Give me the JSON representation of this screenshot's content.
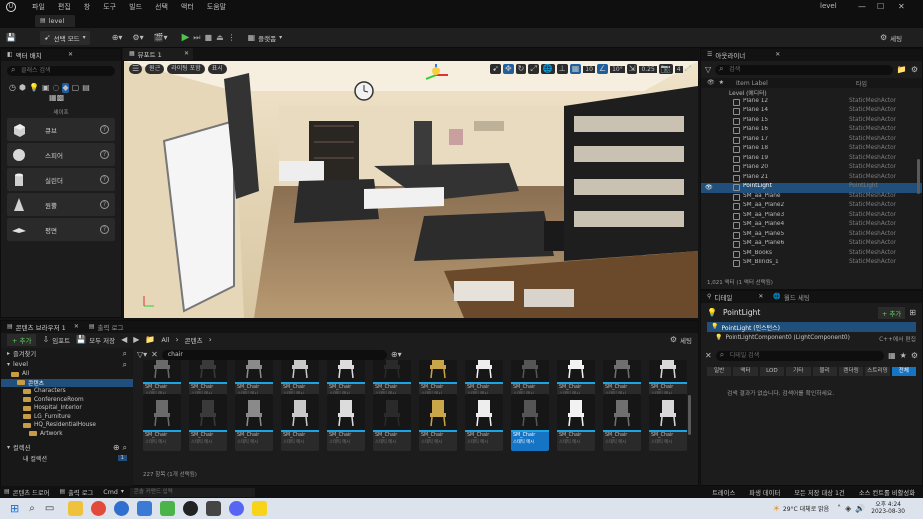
{
  "window": {
    "level_name": "level",
    "tab_label": "level",
    "menu": [
      "파일",
      "편집",
      "창",
      "도구",
      "빌드",
      "선택",
      "액터",
      "도움말"
    ],
    "controls": [
      "—",
      "☐",
      "✕"
    ]
  },
  "toolbar": {
    "save_label": "저장",
    "mode_label": "선택 모드",
    "platform_label": "플랫폼",
    "settings_label": "세팅"
  },
  "place_actors": {
    "tab_label": "액터 배치",
    "search_placeholder": "클래스 검색",
    "category_label": "셰이프",
    "items": [
      {
        "label": "큐브",
        "icon": "cube-icon"
      },
      {
        "label": "스피어",
        "icon": "sphere-icon"
      },
      {
        "label": "실린더",
        "icon": "cylinder-icon"
      },
      {
        "label": "원뿔",
        "icon": "cone-icon"
      },
      {
        "label": "평면",
        "icon": "plane-icon"
      }
    ]
  },
  "viewport": {
    "tab_label": "뷰포트 1",
    "left_buttons": [
      "원근",
      "라이팅 포함",
      "표시"
    ],
    "snap_values": [
      "10",
      "10°",
      "0.25",
      "4"
    ]
  },
  "outliner": {
    "tab_label": "아웃라이너",
    "search_placeholder": "검색",
    "col_item": "Item Label",
    "col_type": "타입",
    "level_row": "Level (에디터)",
    "rows": [
      {
        "name": "Plane 12",
        "type": "StaticMeshActor"
      },
      {
        "name": "Plane 14",
        "type": "StaticMeshActor"
      },
      {
        "name": "Plane 15",
        "type": "StaticMeshActor"
      },
      {
        "name": "Plane 16",
        "type": "StaticMeshActor"
      },
      {
        "name": "Plane 17",
        "type": "StaticMeshActor"
      },
      {
        "name": "Plane 18",
        "type": "StaticMeshActor"
      },
      {
        "name": "Plane 19",
        "type": "StaticMeshActor"
      },
      {
        "name": "Plane 20",
        "type": "StaticMeshActor"
      },
      {
        "name": "Plane 21",
        "type": "StaticMeshActor"
      },
      {
        "name": "PointLight",
        "type": "PointLight",
        "selected": true
      },
      {
        "name": "SM_aa_Plane",
        "type": "StaticMeshActor"
      },
      {
        "name": "SM_aa_Plane2",
        "type": "StaticMeshActor"
      },
      {
        "name": "SM_aa_Plane3",
        "type": "StaticMeshActor"
      },
      {
        "name": "SM_aa_Plane4",
        "type": "StaticMeshActor"
      },
      {
        "name": "SM_aa_Plane5",
        "type": "StaticMeshActor"
      },
      {
        "name": "SM_aa_Plane6",
        "type": "StaticMeshActor"
      },
      {
        "name": "SM_Books",
        "type": "StaticMeshActor"
      },
      {
        "name": "SM_Blinds_1",
        "type": "StaticMeshActor"
      }
    ],
    "footer": "1,021 액터 (1 액터 선택됨)"
  },
  "details": {
    "tab_label": "디테일",
    "tab2_label": "월드 세팅",
    "actor_name": "PointLight",
    "add_label": "+ 추가",
    "component_root": "PointLight (인스턴스)",
    "component_child": "PointLightComponent0 (LightComponent0)",
    "component_child_note": "C++에서 편집",
    "search_placeholder": "디테일 검색",
    "filter_tabs": [
      "일반",
      "액터",
      "LOD",
      "기타",
      "물리",
      "렌더링",
      "스트리밍",
      "전체"
    ],
    "hint": "검색 결과가 없습니다. 검색어를 확인하세요."
  },
  "content_browser": {
    "tab_label": "콘텐츠 브라우저 1",
    "tab2_label": "출력 로그",
    "add_label": "+ 추가",
    "import_label": "임포트",
    "save_all_label": "모두 저장",
    "path": [
      "All",
      "콘텐츠"
    ],
    "settings_label": "세팅",
    "favorites_label": "즐겨찾기",
    "project_label": "level",
    "filter_text": "chair",
    "tree": [
      "All",
      "콘텐츠",
      "Characters",
      "ConferenceRoom",
      "Hospital_Interior",
      "LG_Furniture",
      "HQ_ResidentialHouse",
      "Artwork"
    ],
    "collections_label": "컬렉션",
    "history_label": "내 컬렉션",
    "history_count": "1",
    "status": "227 항목 (1개 선택됨)",
    "row1": [
      {
        "name": "SM_Chair",
        "type": "스태틱 메시"
      },
      {
        "name": "SM_Chair",
        "type": "스태틱 메시"
      },
      {
        "name": "SM_Chair",
        "type": "스태틱 메시"
      },
      {
        "name": "SM_Chair",
        "type": "스태틱 메시"
      },
      {
        "name": "SM_Chair",
        "type": "스태틱 메시"
      },
      {
        "name": "SM_Chair",
        "type": "스태틱 메시"
      },
      {
        "name": "SM_Chair",
        "type": "스태틱 메시"
      },
      {
        "name": "SM_Chair",
        "type": "스태틱 메시"
      },
      {
        "name": "SM_Chair",
        "type": "스태틱 메시"
      },
      {
        "name": "SM_Chair",
        "type": "스태틱 메시"
      },
      {
        "name": "SM_Chair",
        "type": "스태틱 메시"
      },
      {
        "name": "SM_Chair",
        "type": "스태틱 메시"
      }
    ],
    "row2": [
      {
        "name": "SM_Chair",
        "type": "스태틱 메시"
      },
      {
        "name": "SM_Chair",
        "type": "스태틱 메시"
      },
      {
        "name": "SM_Chair",
        "type": "스태틱 메시"
      },
      {
        "name": "SM_Chair",
        "type": "스태틱 메시"
      },
      {
        "name": "SM_Chair",
        "type": "스태틱 메시"
      },
      {
        "name": "SM_Chair",
        "type": "스태틱 메시"
      },
      {
        "name": "SM_Chair",
        "type": "스태틱 메시"
      },
      {
        "name": "SM_Chair",
        "type": "스태틱 메시"
      },
      {
        "name": "SM_Chair",
        "type": "스태틱 메시",
        "selected": true
      },
      {
        "name": "SM_Chair",
        "type": "스태틱 메시"
      },
      {
        "name": "SM_Chair",
        "type": "스태틱 메시"
      },
      {
        "name": "SM_Chair",
        "type": "스태틱 메시"
      }
    ]
  },
  "statusbar": {
    "left": [
      "콘텐츠 드로어",
      "출력 로그",
      "Cmd"
    ],
    "cmd_placeholder": "콘솔 커맨드 입력",
    "right": [
      "트레이스",
      "파생 데이터",
      "모든 저장 대상 1건",
      "소스 컨트롤 비활성화"
    ]
  },
  "taskbar": {
    "weather": "29°C 대체로 맑음",
    "time": "오후 4:24",
    "date": "2023-08-30"
  }
}
